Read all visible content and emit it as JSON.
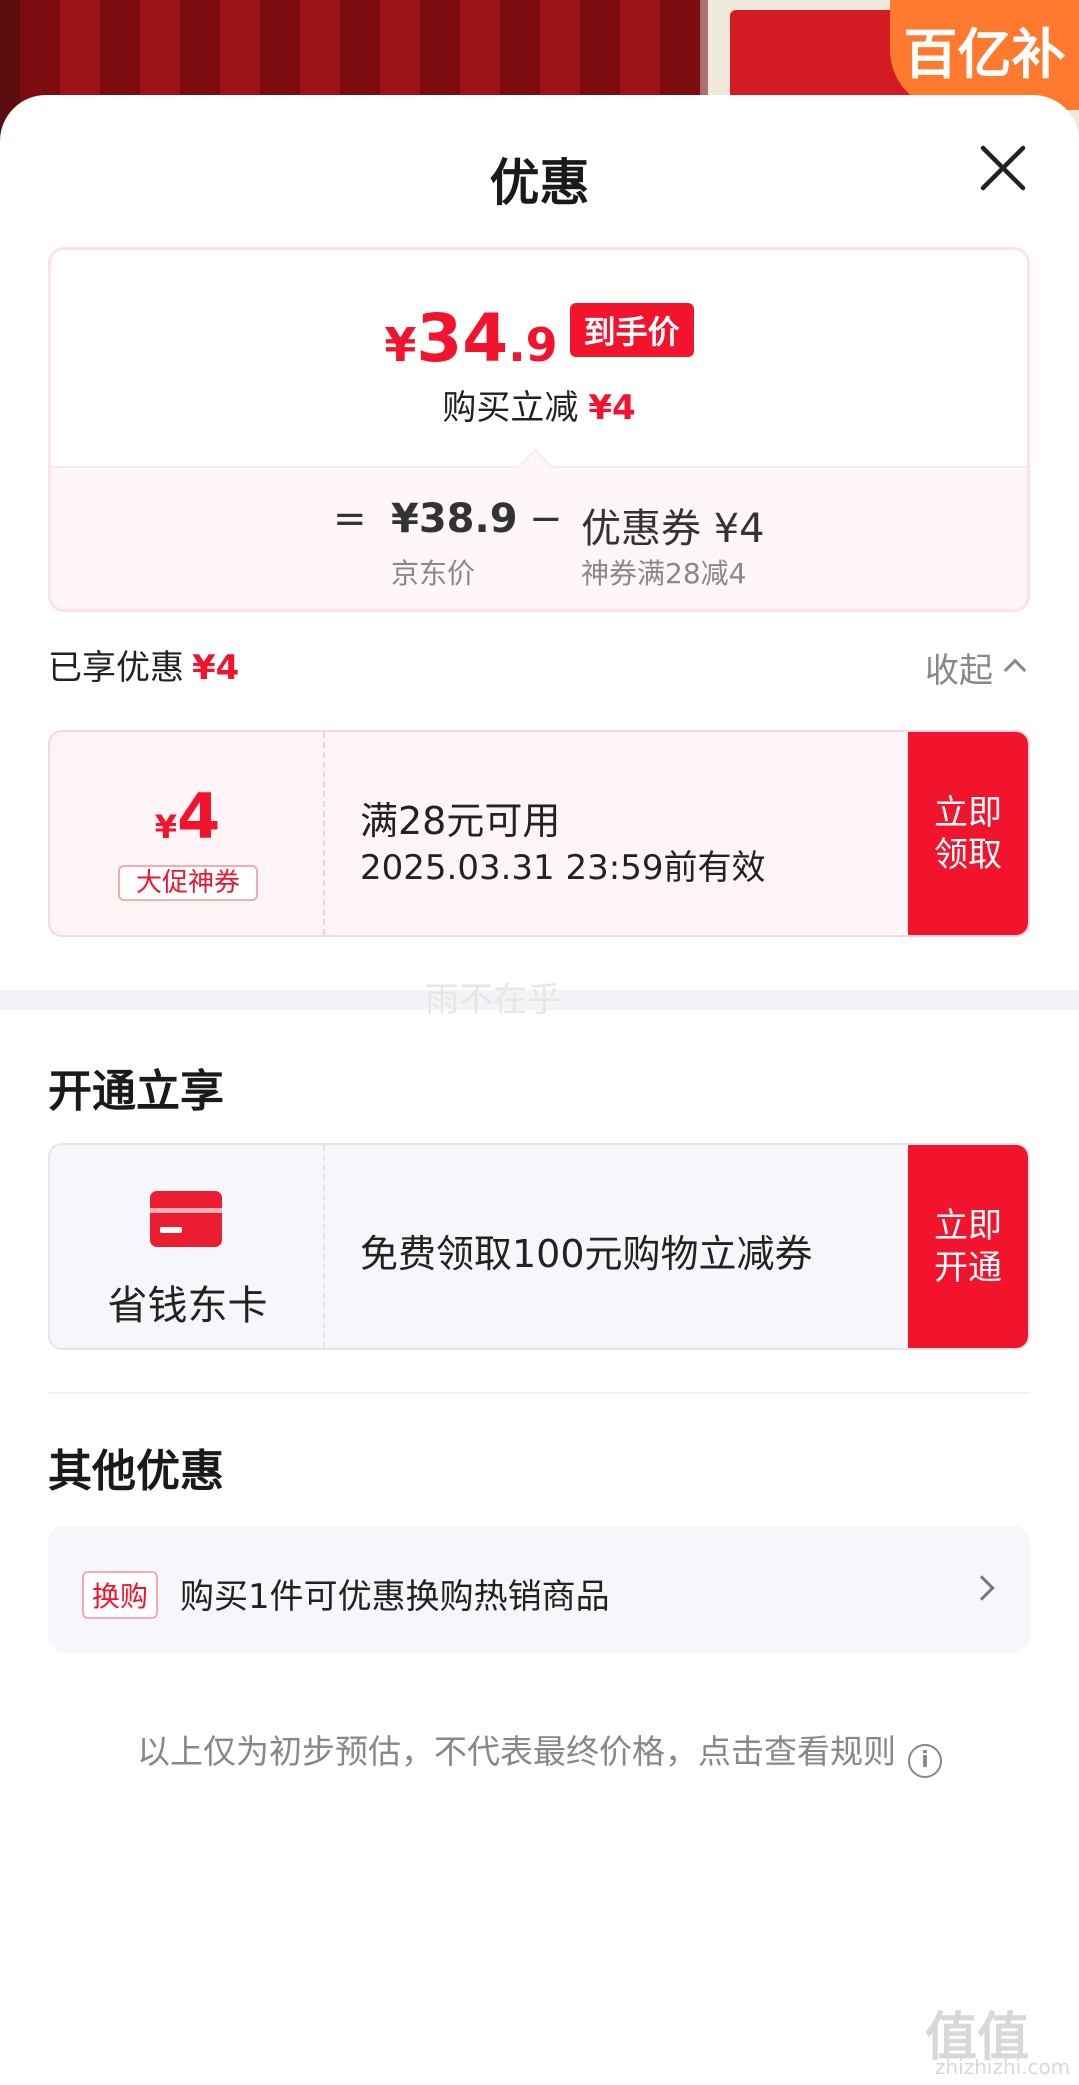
{
  "background": {
    "badge_text": "百亿补贴"
  },
  "sheet": {
    "title": "优惠",
    "close_icon": "close-icon"
  },
  "price": {
    "yen": "¥",
    "integer": "34",
    "decimal": ".9",
    "tag": "到手价",
    "sub_label": "购买立减",
    "sub_amount": "¥4",
    "eq": "=",
    "jd_price": "¥38.9",
    "jd_price_label": "京东价",
    "minus": "−",
    "coupon_label": "优惠券 ¥4",
    "coupon_desc": "神券满28减4"
  },
  "enjoyed": {
    "label": "已享优惠",
    "amount": "¥4",
    "collapse": "收起"
  },
  "coupon": {
    "yen": "¥",
    "amount": "4",
    "badge": "大促神券",
    "condition": "满28元可用",
    "expiry": "2025.03.31 23:59前有效",
    "button_line1": "立即",
    "button_line2": "领取"
  },
  "watermark": "雨不在乎",
  "membership": {
    "section_title": "开通立享",
    "card_name": "省钱东卡",
    "card_icon": "card-icon",
    "description": "免费领取100元购物立减券",
    "button_line1": "立即",
    "button_line2": "开通"
  },
  "other": {
    "section_title": "其他优惠",
    "tag": "换购",
    "text": "购买1件可优惠换购热销商品"
  },
  "footnote": {
    "text": "以上仅为初步预估，不代表最终价格，点击查看规则",
    "icon": "i"
  },
  "brand": {
    "name": "值值值",
    "url": "zhizhizhi.com"
  },
  "colors": {
    "accent": "#f2142c",
    "text": "#222222",
    "muted": "#888888"
  }
}
